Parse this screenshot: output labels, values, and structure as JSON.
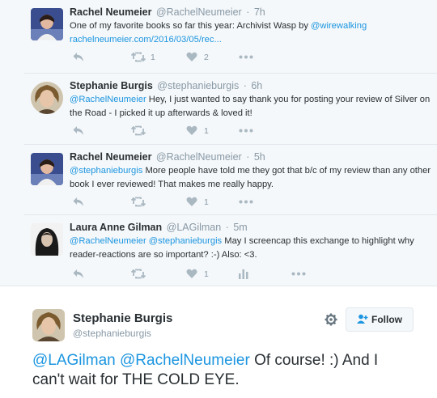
{
  "tweets": [
    {
      "name": "Rachel Neumeier",
      "handle": "@RachelNeumeier",
      "time": "7h",
      "text_before": "One of my favorite books so far this year: Archivist Wasp by ",
      "mention": "@wirewalking",
      "link": "rachelneumeier.com/2016/03/05/rec...",
      "retweets": "1",
      "likes": "2"
    },
    {
      "name": "Stephanie Burgis",
      "handle": "@stephanieburgis",
      "time": "6h",
      "mention": "@RachelNeumeier",
      "text": " Hey, I just wanted to say thank you for posting your review of Silver on the Road - I picked it up afterwards & loved it!",
      "likes": "1"
    },
    {
      "name": "Rachel Neumeier",
      "handle": "@RachelNeumeier",
      "time": "5h",
      "mention": "@stephanieburgis",
      "text": " More people have told me they got that b/c of my review than any other book I ever reviewed! That makes me really happy.",
      "likes": "1"
    },
    {
      "name": "Laura Anne Gilman",
      "handle": "@LAGilman",
      "time": "5m",
      "mention1": "@RachelNeumeier",
      "mention2": "@stephanieburgis",
      "text": " May I screencap this exchange to highlight why reader-reactions are so important?  :-)  Also: <3.",
      "likes": "1"
    }
  ],
  "detail": {
    "name": "Stephanie Burgis",
    "handle": "@stephanieburgis",
    "follow_label": "Follow",
    "mention1": "@LAGilman",
    "mention2": "@RachelNeumeier",
    "text": " Of course! :) And I can't wait for THE COLD EYE."
  },
  "icons": [
    "reply-icon",
    "retweet-icon",
    "like-icon",
    "more-icon",
    "analytics-icon",
    "gear-icon",
    "add-user-icon"
  ],
  "colors": {
    "link": "#1b95e0",
    "name": "#292f33",
    "meta": "#8899a6",
    "icon": "#aab8c2"
  }
}
